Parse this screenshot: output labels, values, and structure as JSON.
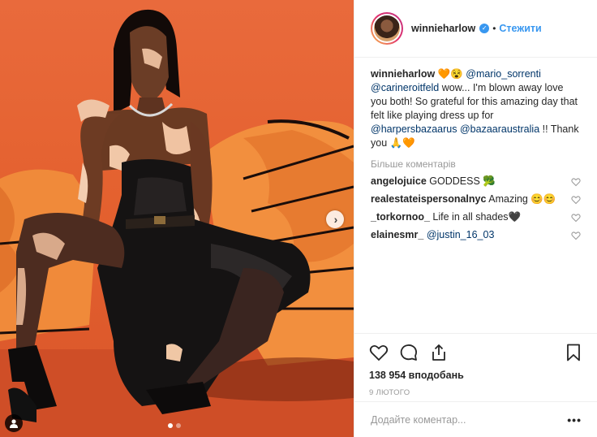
{
  "post": {
    "author": {
      "username": "winnieharlow",
      "verified": true,
      "separator": "•",
      "follow_label": "Стежити"
    },
    "caption": {
      "username": "winnieharlow",
      "emoji": "🧡😵",
      "mention1": "@mario_sorrenti",
      "mention2": "@carineroitfeld",
      "text1": "wow... I'm blown away love you both! So grateful for this amazing day that felt like playing dress up for",
      "mention3": "@harpersbazaarus",
      "mention4": "@bazaaraustralia",
      "text2": "!! Thank you 🙏🧡"
    },
    "more_comments_label": "Більше коментарів",
    "comments": [
      {
        "user": "angelojuice",
        "text": "GODDESS 🥦"
      },
      {
        "user": "realestateispersonalnyc",
        "text": "Amazing 😊😊"
      },
      {
        "user": "_torkornoo_",
        "text": "Life in all shades🖤"
      },
      {
        "user": "elainesmr_",
        "text": "",
        "mention": "@justin_16_03"
      }
    ],
    "likes_label": "138 954 вподобань",
    "date_label": "9 ЛЮТОГО",
    "add_comment_placeholder": "Додайте коментар...",
    "more_options_label": "•••",
    "carousel": {
      "slides": 2,
      "active": 1
    }
  },
  "colors": {
    "accent": "#3897f0",
    "link": "#003569",
    "muted": "#999999",
    "background_photo": "#e4612f"
  },
  "icons": [
    "heart-icon",
    "comment-icon",
    "share-icon",
    "bookmark-icon",
    "chevron-right-icon",
    "user-tag-icon",
    "verified-icon"
  ]
}
